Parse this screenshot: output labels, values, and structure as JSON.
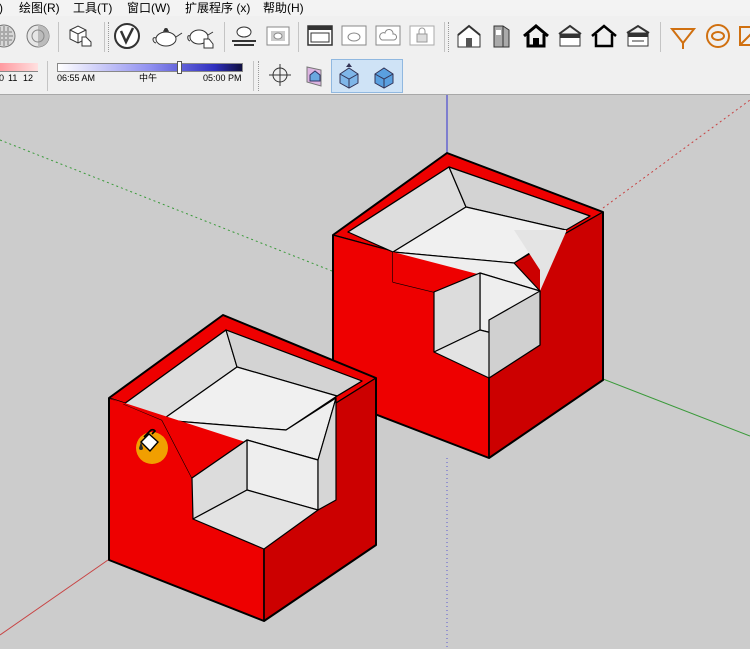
{
  "menubar": {
    "items": [
      {
        "label": ")"
      },
      {
        "label": "绘图(R)"
      },
      {
        "label": "工具(T)"
      },
      {
        "label": "窗口(W)"
      },
      {
        "label": "扩展程序 (x)"
      },
      {
        "label": "帮助(H)"
      }
    ]
  },
  "shadow_settings": {
    "month_labels": [
      "0",
      "11",
      "12"
    ],
    "time_start": "06:55 AM",
    "time_mid": "中午",
    "time_end": "05:00 PM"
  },
  "toolbar": {
    "icons": [
      "xray-style-icon",
      "back-edges-style-icon",
      "component-interact-icon",
      "vray-logo-icon",
      "teapot-render-icon",
      "teapot-interactive-icon",
      "teapot-floor-icon",
      "frame-buffer-icon",
      "window-icon",
      "teapot-window-icon",
      "cloud-icon",
      "lock-icon",
      "warehouse-icon",
      "extension-warehouse-icon",
      "home-icon",
      "house-upload-icon",
      "house-outline-icon",
      "house-share-icon",
      "section-cut-icon",
      "dynamic-component-icon",
      "section-plane-icon"
    ],
    "view_icons": [
      "orbit-axes-icon",
      "perspective-house-icon",
      "iso-house-icon",
      "iso-house-selected-icon"
    ]
  },
  "viewport": {
    "colors": {
      "background": "#cccccc",
      "face_red": "#ee0000",
      "face_red_dark": "#cc0000",
      "inner_light": "#eeeeee",
      "inner_mid": "#e0e0e0",
      "inner_dark": "#d3d3d3",
      "edge": "#000000",
      "axis_red": "#c84444",
      "axis_green": "#3a9a3a",
      "axis_blue": "#4a4ad0",
      "cursor_highlight": "#f2d400"
    },
    "cursor": "paint-bucket-cursor"
  }
}
